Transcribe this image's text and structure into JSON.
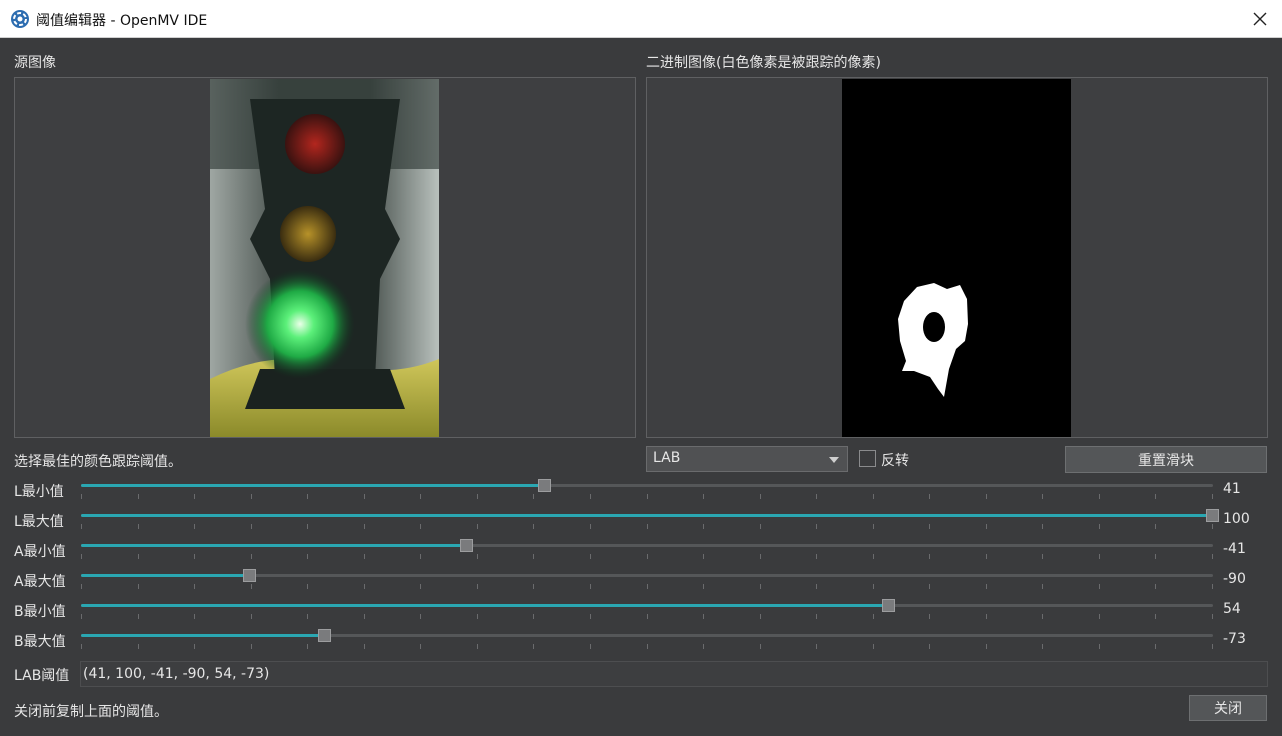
{
  "window": {
    "title": "阈值编辑器 - OpenMV IDE",
    "icon": "openmv-icon",
    "close_icon": "close-icon"
  },
  "source_panel": {
    "label": "源图像"
  },
  "binary_panel": {
    "label": "二进制图像(白色像素是被跟踪的像素)"
  },
  "hint": "选择最佳的颜色跟踪阈值。",
  "mode_select": {
    "selected": "LAB"
  },
  "invert_checkbox": {
    "label": "反转",
    "checked": false
  },
  "reset_button": {
    "label": "重置滑块"
  },
  "sliders": [
    {
      "label": "L最小值",
      "value": "41",
      "min": 0,
      "max": 100,
      "pos": 41
    },
    {
      "label": "L最大值",
      "value": "100",
      "min": 0,
      "max": 100,
      "pos": 100
    },
    {
      "label": "A最小值",
      "value": "-41",
      "min": -128,
      "max": 127,
      "pos": -41
    },
    {
      "label": "A最大值",
      "value": "-90",
      "min": -128,
      "max": 127,
      "pos": -90
    },
    {
      "label": "B最小值",
      "value": "54",
      "min": -128,
      "max": 127,
      "pos": 54
    },
    {
      "label": "B最大值",
      "value": "-73",
      "min": -128,
      "max": 127,
      "pos": -73
    }
  ],
  "lab_threshold": {
    "label": "LAB阈值",
    "value": "(41, 100, -41, -90, 54, -73)"
  },
  "footer": {
    "hint": "关闭前复制上面的阈值。",
    "close_label": "关闭"
  },
  "colors": {
    "accent": "#2aa7b2",
    "background": "#3a3b3d",
    "panel": "#3e3f41"
  }
}
